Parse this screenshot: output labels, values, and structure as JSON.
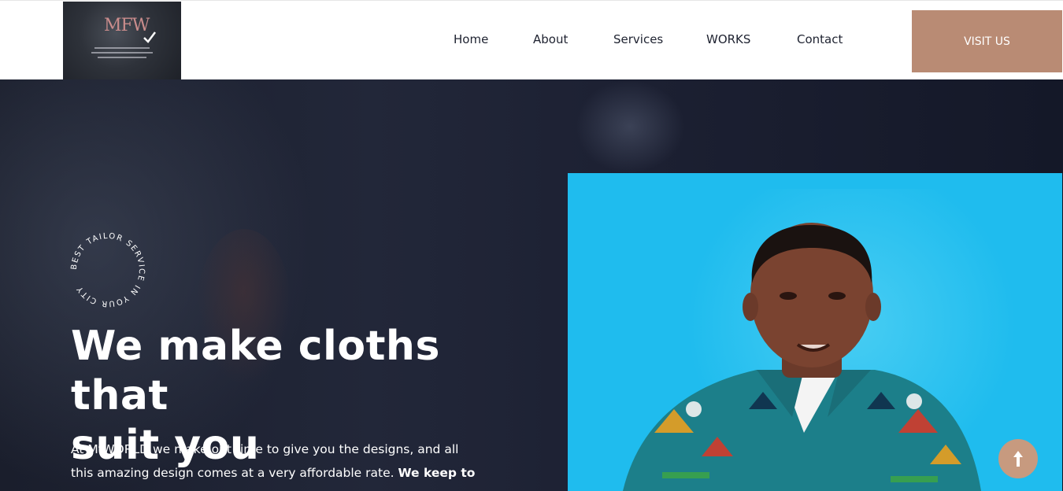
{
  "header": {
    "nav": [
      {
        "label": "Home"
      },
      {
        "label": "About"
      },
      {
        "label": "Services"
      },
      {
        "label": "WORKS"
      },
      {
        "label": "Contact"
      }
    ],
    "cta_label": "VISIT US",
    "logo_text": "MFW"
  },
  "hero": {
    "badge_text": "BEST TAILOR SERVICE IN YOUR CITY",
    "headline_line1": "We make cloths that",
    "headline_line2": "suit you",
    "para_line1": "At MfWORLD we make out time to give you the designs, and all",
    "para_line2_plain": "this amazing design comes at a very affordable rate. ",
    "para_line2_bold": "We keep to"
  },
  "colors": {
    "accent": "#b98b74",
    "hero_bg": "#1c2032",
    "photo_bg": "#1fbcee"
  },
  "icons": {
    "scroll_top": "arrow-up-icon"
  }
}
